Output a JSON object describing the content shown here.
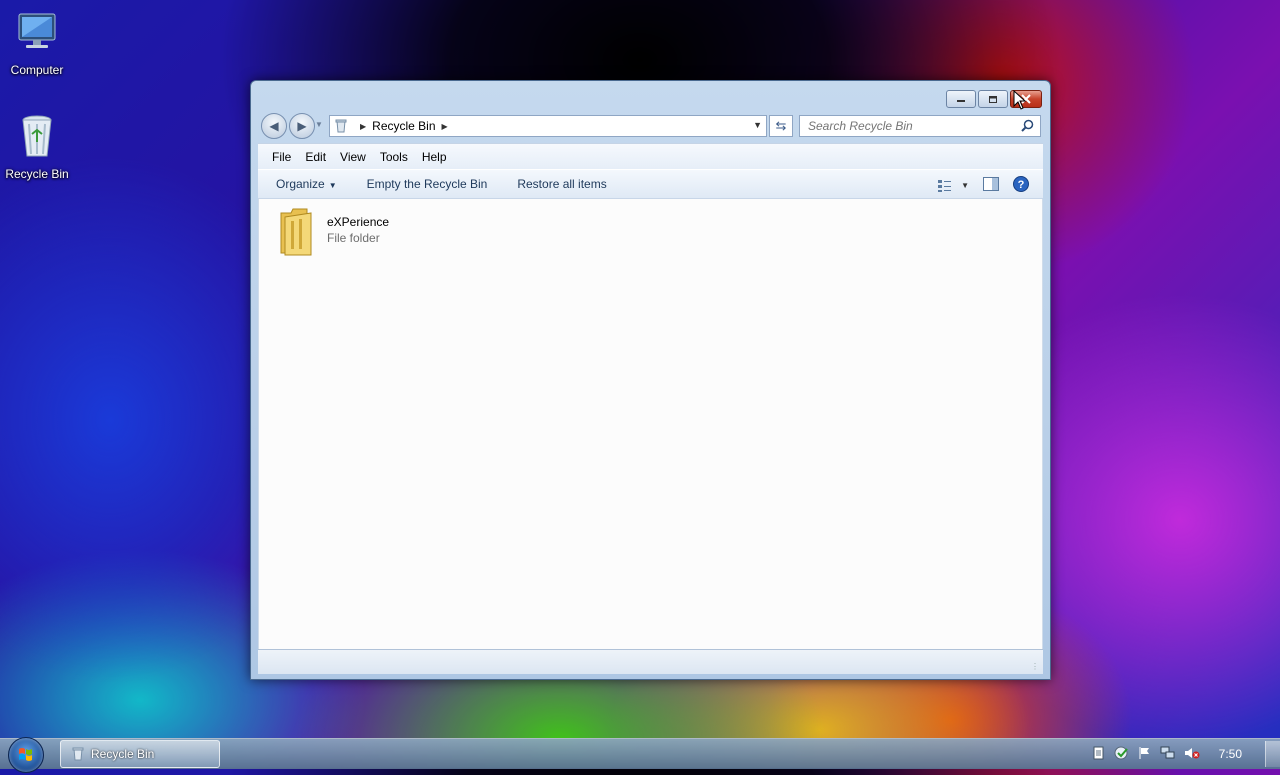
{
  "desktop": {
    "icons": [
      {
        "label": "Computer",
        "icon": "computer-icon"
      },
      {
        "label": "Recycle Bin",
        "icon": "recycle-bin-icon"
      }
    ]
  },
  "window": {
    "title": "Recycle Bin",
    "address": {
      "segment": "Recycle Bin"
    },
    "search": {
      "placeholder": "Search Recycle Bin"
    },
    "menu": [
      "File",
      "Edit",
      "View",
      "Tools",
      "Help"
    ],
    "toolbar": {
      "organize": "Organize",
      "empty": "Empty the Recycle Bin",
      "restore": "Restore all items"
    },
    "items": [
      {
        "name": "eXPerience",
        "type": "File folder",
        "icon": "folder-icon"
      }
    ]
  },
  "taskbar": {
    "task_label": "Recycle Bin",
    "clock": "7:50",
    "tray_icons": [
      "document-icon",
      "security-check-icon",
      "flag-icon",
      "network-icon",
      "volume-muted-icon"
    ]
  },
  "colors": {
    "window_frame": "#b9cfe8",
    "close_button": "#c7432b",
    "toolbar_text": "#1e395b"
  }
}
